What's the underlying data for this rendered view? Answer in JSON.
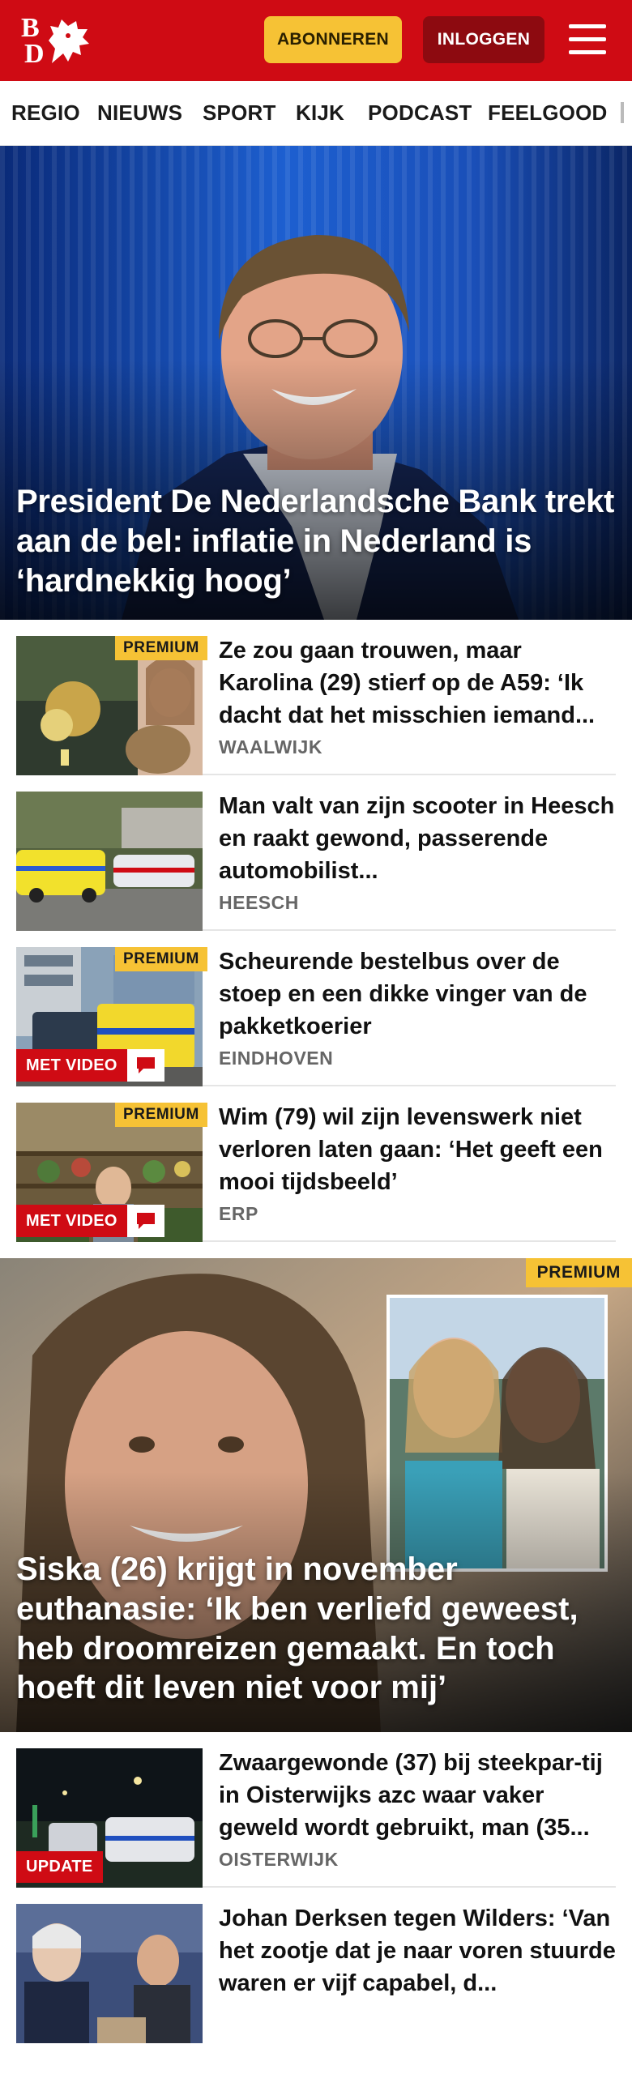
{
  "header": {
    "logo_letters": [
      "B",
      "D"
    ],
    "subscribe_label": "ABONNEREN",
    "login_label": "INLOGGEN",
    "menu_icon": "hamburger-icon",
    "brand_color": "#cf0b14"
  },
  "nav": {
    "items": [
      "REGIO",
      "NIEUWS",
      "SPORT",
      "KIJK",
      "PODCAST",
      "FEELGOOD"
    ]
  },
  "hero": {
    "title": "President De Nederlandsche Bank trekt aan de bel: inflatie in Nederland is ‘hardnekkig hoog’"
  },
  "articles": [
    {
      "title": "Ze zou gaan trouwen, maar Karolina (29) stierf op de A59: ‘Ik dacht dat het misschien iemand...",
      "location": "WAALWIJK",
      "premium": "PREMIUM"
    },
    {
      "title": "Man valt van zijn scooter in Heesch en raakt gewond, passerende automobilist...",
      "location": "HEESCH"
    },
    {
      "title": "Scheurende bestelbus over de stoep en een dikke vinger van de pakketkoerier",
      "location": "EINDHOVEN",
      "premium": "PREMIUM",
      "video": "MET VIDEO"
    },
    {
      "title": "Wim (79) wil zijn levenswerk niet verloren laten gaan: ‘Het geeft een mooi tijdsbeeld’",
      "location": "ERP",
      "premium": "PREMIUM",
      "video": "MET VIDEO"
    }
  ],
  "feature": {
    "premium": "PREMIUM",
    "title": "Siska (26) krijgt in november euthanasie: ‘Ik ben verliefd geweest, heb droomreizen gemaakt. En toch hoeft dit leven niet voor mij’"
  },
  "articles2": [
    {
      "title": "Zwaargewonde (37) bij steekpar-tij in Oisterwijks azc waar vaker geweld wordt gebruikt, man (35...",
      "location": "OISTERWIJK",
      "update": "UPDATE"
    },
    {
      "title": "Johan Derksen tegen Wilders: ‘Van het zootje dat je naar voren stuurde waren er vijf capabel, d..."
    }
  ]
}
